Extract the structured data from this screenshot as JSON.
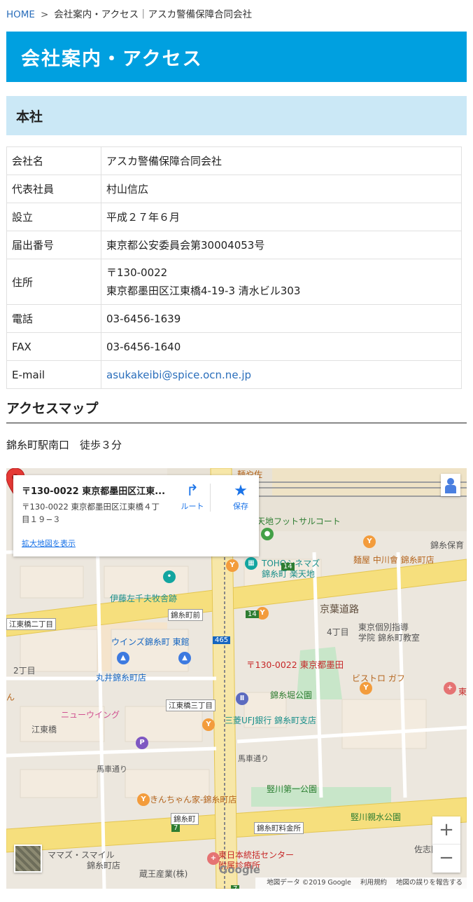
{
  "breadcrumb": {
    "home": "HOME",
    "separator": ">",
    "current": "会社案内・アクセス｜アスカ警備保障合同会社"
  },
  "page_title": "会社案内・アクセス",
  "section_title": "本社",
  "company_info": [
    {
      "key": "会社名",
      "value": "アスカ警備保障合同会社"
    },
    {
      "key": "代表社員",
      "value": "村山信広"
    },
    {
      "key": "設立",
      "value": "平成２７年６月"
    },
    {
      "key": "届出番号",
      "value": "東京都公安委員会第30004053号"
    },
    {
      "key": "住所",
      "value": "〒130-0022",
      "value2": "東京都墨田区江東橋4-19-3 清水ビル303"
    },
    {
      "key": "電話",
      "value": "03-6456-1639"
    },
    {
      "key": "FAX",
      "value": "03-6456-1640"
    },
    {
      "key": "E-mail",
      "value": "asukakeibi@spice.ocn.ne.jp"
    }
  ],
  "access": {
    "heading": "アクセスマップ",
    "note": "錦糸町駅南口　徒歩３分"
  },
  "map": {
    "card": {
      "title": "〒130-0022 東京都墨田区江東...",
      "address": "〒130-0022 東京都墨田区江東橋４丁目１９−３",
      "view_larger": "拡大地図を表示",
      "route_label": "ルート",
      "save_label": "保存"
    },
    "marker_label": "〒130-0022 東京都墨田",
    "labels": {
      "futsal": "天地フットサルコート",
      "toho1": "TOHOシネマズ",
      "toho2": "錦糸町 楽天地",
      "menya": "麺屋 中川會 錦糸町店",
      "nishikihoiku": "錦糸保育",
      "ito": "伊藤左千夫牧舎跡",
      "keiyo": "京葉道路",
      "tokyo1": "東京個別指導",
      "tokyo2": "学院 錦糸町教室",
      "yonchome": "4丁目",
      "winds": "ウインズ錦糸町 東館",
      "marui": "丸井錦糸町店",
      "nichome": "2丁目",
      "bistro": "ビストロ ガフ",
      "park": "錦糸堀公園",
      "newwing": "ニューウイング",
      "koto": "江東橋",
      "mufg": "三菱UFJ銀行 錦糸町支店",
      "bashadori1": "馬車通り",
      "bashadori2": "馬車通り",
      "kinchan": "きんちゃん家-錦糸町店",
      "tatekawa1": "竪川第一公園",
      "tatekawa2": "竪川親水公園",
      "mamasu1": "ママズ・スマイル",
      "mamasu2": "錦糸町店",
      "zao": "蔵王産業(株)",
      "higashi1": "東日本統括センター",
      "higashi2": "附属診療所",
      "sashida": "佐志田",
      "menyasaku": "麺や佐",
      "higashi_edge": "東",
      "n_edge": "ん",
      "int_kinshi": "錦糸町前",
      "int_koto3": "江東橋三丁目",
      "int_koto2": "江東橋二丁目",
      "int_ryokin": "錦糸町料金所",
      "int_kinshi2": "錦糸町",
      "route14a": "14",
      "route14b": "14",
      "route465": "465",
      "route7a": "7",
      "route7b": "7"
    },
    "attribution": {
      "data": "地図データ ©2019 Google",
      "terms": "利用規約",
      "report": "地図の誤りを報告する"
    },
    "logo": "Google",
    "zoom_in": "+",
    "zoom_out": "−"
  },
  "colors": {
    "title_bar": "#00a0e0",
    "section_bar": "#cbe8f6",
    "link": "#2a6ebb",
    "marker": "#e53935"
  }
}
